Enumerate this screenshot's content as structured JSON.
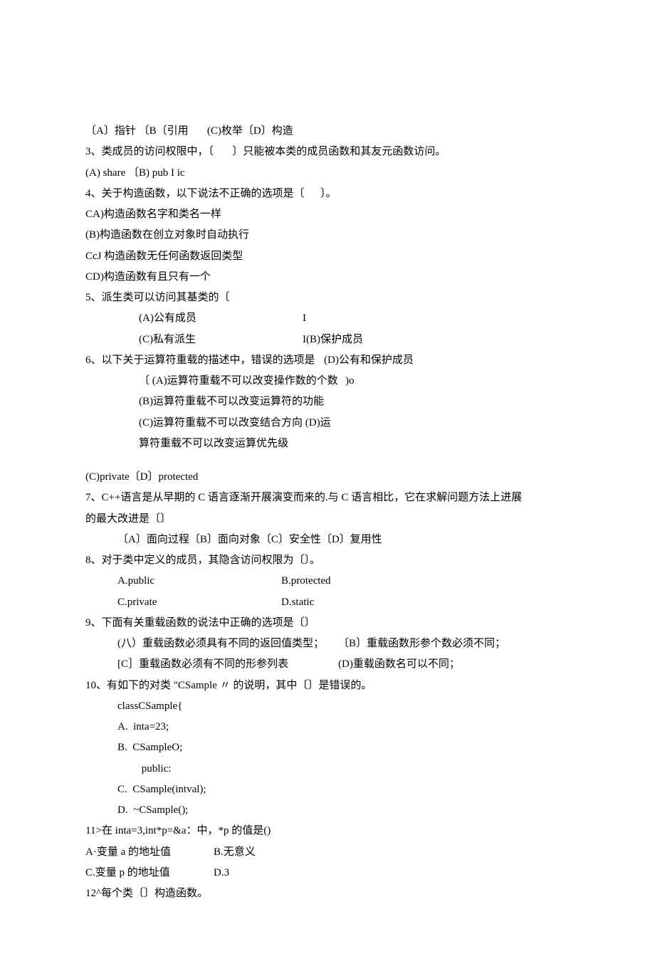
{
  "l01": "〔A〕指针 〔B〔引用       (C)枚举〔D〕构造",
  "l02": "3、类成员的访问权限中，〔       〕只能被本类的成员函数和其友元函数访问。",
  "l03": "(A) share 〔B) pub I ic",
  "l04": "4、关于构造函数，以下说法不正确的选项是〔      〕。",
  "l05": "CA)构造函数名字和类名一样",
  "l06": "(B)构造函数在创立对象时自动执行",
  "l07": "CcJ 构造函数无任何函数返回类型",
  "l08": "CD)构造函数有且只有一个",
  "l09": "5、派生类可以访问其基类的〔",
  "l10a": "(A)公有成员",
  "l10b": "I",
  "l11a": "(C)私有派生",
  "l11b": "I(B)保护成员",
  "l12a": "6、以下关于运算符重载的描述中，错误的选项是",
  "l12b": "(D)公有和保护成员",
  "l13a": "〔 (A)运算符重载不可以改变操作数的个数",
  "l13b": ")o",
  "l14": "(B)运算符重载不可以改变运算符的功能",
  "l15": "(C)运算符重载不可以改变结合方向 (D)运",
  "l16": "算符重载不可以改变运算优先级",
  "l17": "(C)private〔D〕protected",
  "l18": "7、C++语言是从早期的 C 语言逐渐开展演变而来的.与 C 语言相比，它在求解问题方法上进展",
  "l19": "的最大改进是〔〕",
  "l20": "〔A〕面向过程〔B〕面向对象〔C〕安全性〔D〕复用性",
  "l21": "8、对于类中定义的成员，其隐含访问权限为〔〕。",
  "l22a": "A.public",
  "l22b": "B.protected",
  "l23a": "C.private",
  "l23b": "D.static",
  "l24": "9、下面有关重载函数的说法中正确的选项是〔〕",
  "l25a": "(八）重载函数必须具有不同的返回值类型；",
  "l25b": "〔B〕重载函数形参个数必须不同；",
  "l26a": "[C］重载函数必须有不同的形参列表",
  "l26b": "(D)重载函数名可以不同；",
  "l27": "10、有如下的对类 \"CSample 〃 的说明，其中〔〕是错误的。",
  "l28": "classCSample{",
  "l29": "A.  inta=23;",
  "l30": "B.  CSampleO;",
  "l31": " public:",
  "l32": "C.  CSample(intval);",
  "l33": "D.  ~CSample();",
  "l34": "11>在 inta=3,int*p=&a：中，*p 的值是()",
  "l35a": "A·变量 a 的地址值",
  "l35b": "B.无意义",
  "l36a": "C.变量 p 的地址值",
  "l36b": "D.3",
  "l37": "12^每个类〔〕构造函数。"
}
